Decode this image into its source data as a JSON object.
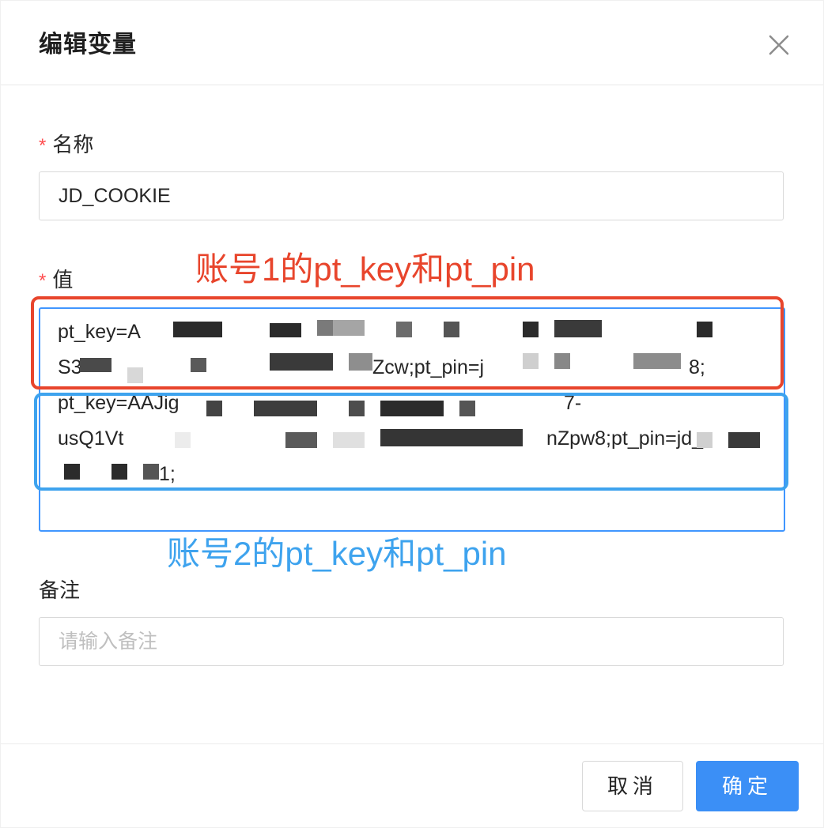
{
  "dialog": {
    "title": "编辑变量",
    "close_icon": "close-icon"
  },
  "form": {
    "name": {
      "required_mark": "*",
      "label": "名称",
      "value": "JD_COOKIE"
    },
    "value": {
      "required_mark": "*",
      "label": "值",
      "lines": [
        "pt_key=A",
        "S3",
        "Zcw;pt_pin=j",
        "8;",
        "pt_key=AAJig",
        "7-",
        "usQ1Vt",
        "nZpw8;pt_pin=jd_",
        "1;"
      ]
    },
    "remark": {
      "label": "备注",
      "placeholder": "请输入备注"
    }
  },
  "annotations": {
    "account1": "账号1的pt_key和pt_pin",
    "account2": "账号2的pt_key和pt_pin",
    "account1_color": "#e8452c",
    "account2_color": "#3ea3ee"
  },
  "footer": {
    "cancel_label": "取消",
    "ok_label": "确定",
    "primary_color": "#3b8ff6"
  }
}
